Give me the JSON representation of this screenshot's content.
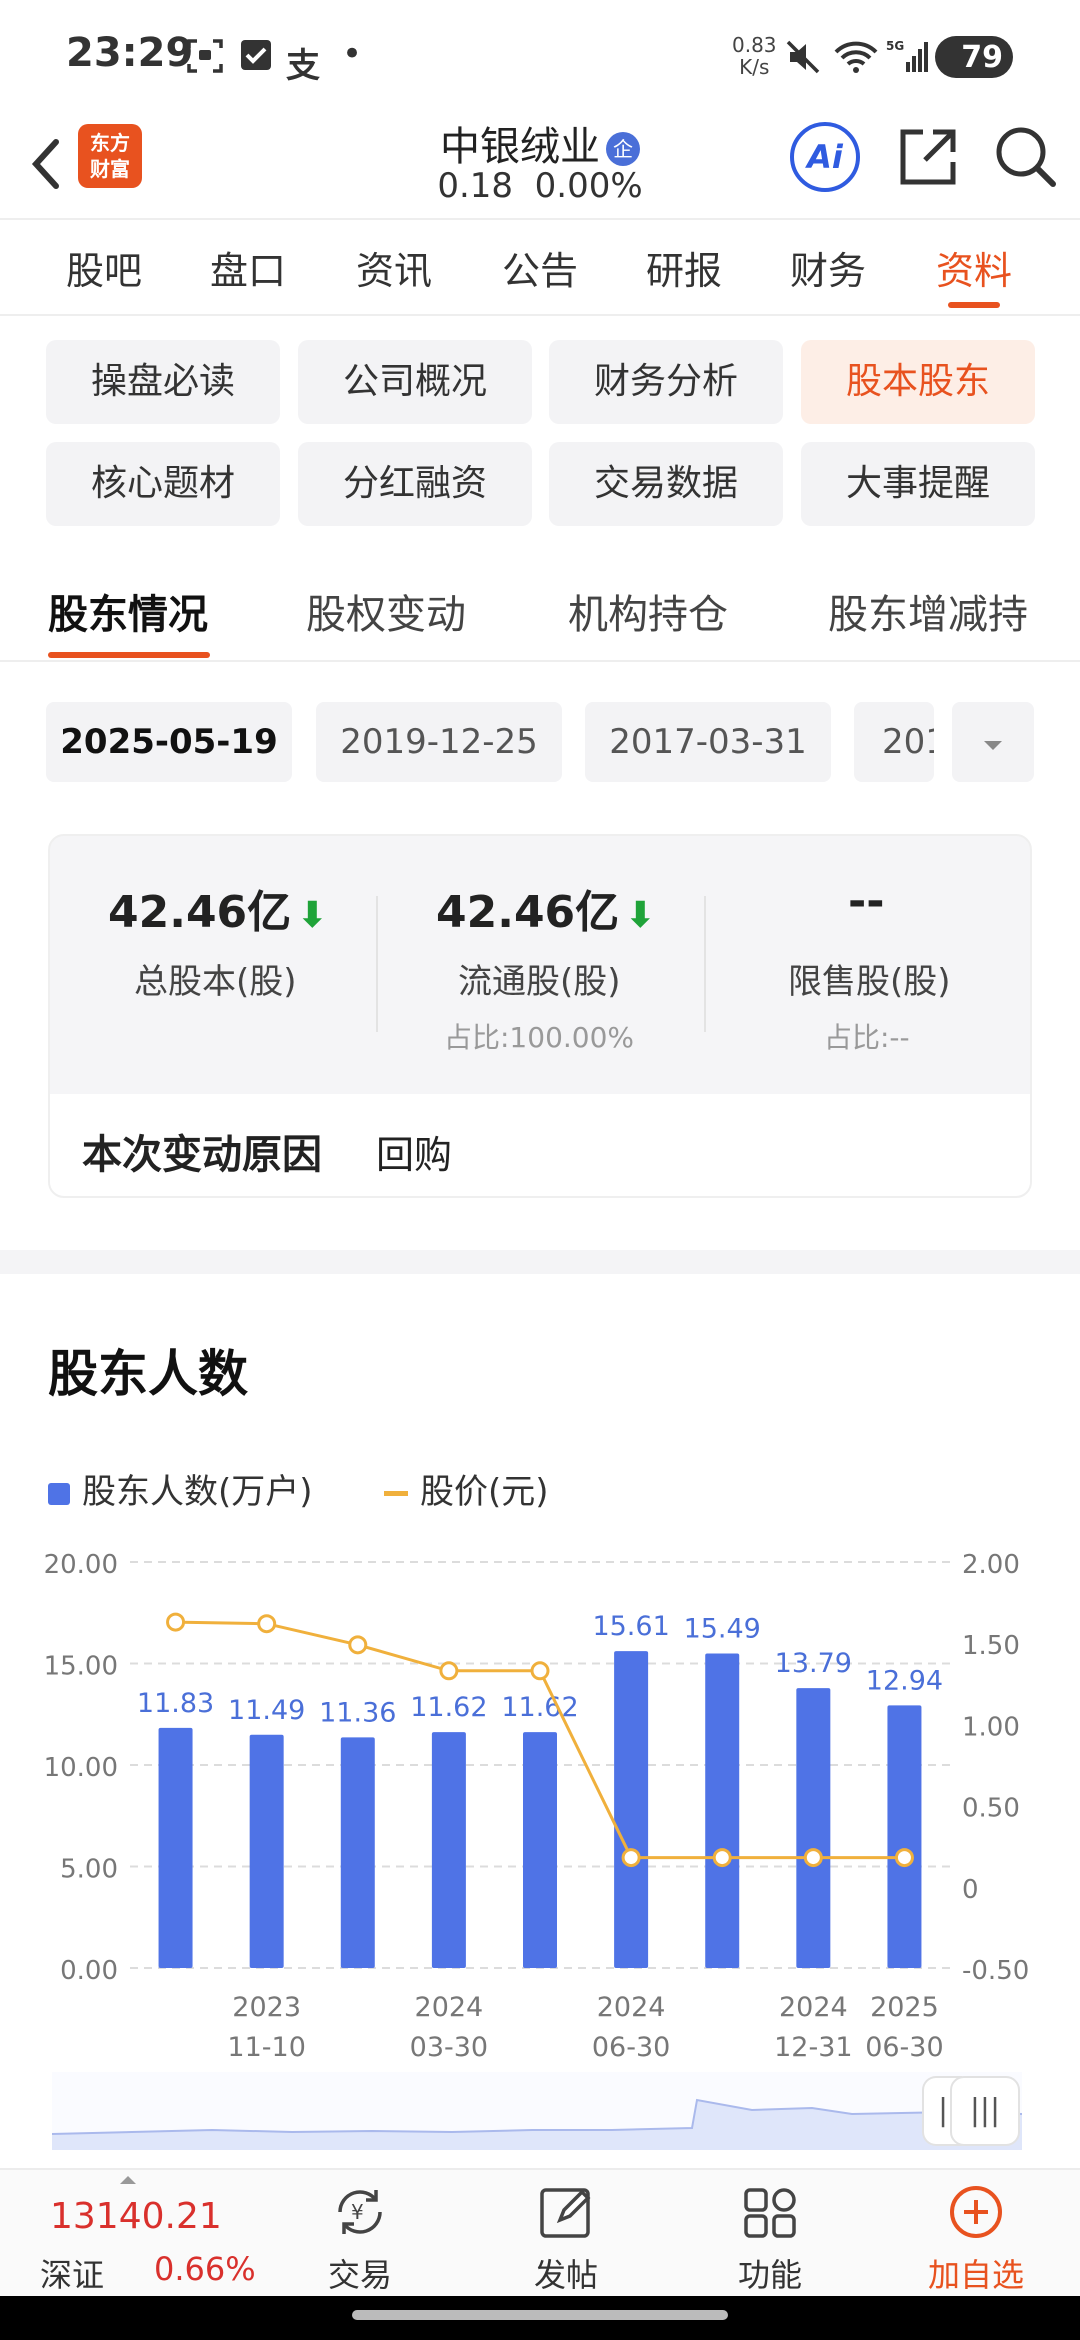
{
  "status_bar": {
    "time": "23:29",
    "icons": [
      "screenshot-icon",
      "check-icon",
      "alipay-icon",
      "dot-icon"
    ],
    "net_speed_value": "0.83",
    "net_speed_unit": "K/s",
    "battery": "79"
  },
  "header": {
    "logo_line1": "东方",
    "logo_line2": "财富",
    "stock_name": "中银绒业",
    "badge": "企",
    "price": "0.18",
    "change": "0.00%",
    "ai_label": "Ai"
  },
  "main_tabs": [
    {
      "label": "股吧"
    },
    {
      "label": "盘口"
    },
    {
      "label": "资讯"
    },
    {
      "label": "公告"
    },
    {
      "label": "研报"
    },
    {
      "label": "财务"
    },
    {
      "label": "资料"
    }
  ],
  "sub_menu": [
    {
      "label": "操盘必读"
    },
    {
      "label": "公司概况"
    },
    {
      "label": "财务分析"
    },
    {
      "label": "股本股东"
    },
    {
      "label": "核心题材"
    },
    {
      "label": "分红融资"
    },
    {
      "label": "交易数据"
    },
    {
      "label": "大事提醒"
    }
  ],
  "shareholder_tabs": [
    {
      "label": "股东情况"
    },
    {
      "label": "股权变动"
    },
    {
      "label": "机构持仓"
    },
    {
      "label": "股东增减持"
    }
  ],
  "dates": [
    "2025-05-19",
    "2019-12-25",
    "2017-03-31",
    "201"
  ],
  "share_card": {
    "total": {
      "value": "42.46亿",
      "label": "总股本(股)"
    },
    "float": {
      "value": "42.46亿",
      "label": "流通股(股)",
      "ratio": "占比:100.00%"
    },
    "restricted": {
      "value": "--",
      "label": "限售股(股)",
      "ratio": "占比:--"
    },
    "reason_label": "本次变动原因",
    "reason_value": "回购"
  },
  "chart_section": {
    "title": "股东人数",
    "legend_bar": "股东人数(万户)",
    "legend_line": "股价(元)"
  },
  "chart_data": {
    "type": "bar",
    "left_axis_ticks": [
      "20.00",
      "15.00",
      "10.00",
      "5.00",
      "0.00"
    ],
    "right_axis_ticks": [
      "2.00",
      "1.50",
      "1.00",
      "0.50",
      "0",
      "-0.50"
    ],
    "ylim_left": [
      0,
      20
    ],
    "ylim_right": [
      -0.5,
      2.0
    ],
    "x_labels": [
      {
        "index": 1,
        "year": "2023",
        "date": "11-10"
      },
      {
        "index": 3,
        "year": "2024",
        "date": "03-30"
      },
      {
        "index": 5,
        "year": "2024",
        "date": "06-30"
      },
      {
        "index": 7,
        "year": "2024",
        "date": "12-31"
      },
      {
        "index": 8,
        "year": "2025",
        "date": "06-30"
      }
    ],
    "series": [
      {
        "name": "股东人数(万户)",
        "kind": "bar",
        "color": "#4f73e6",
        "values": [
          11.83,
          11.49,
          11.36,
          11.62,
          11.62,
          15.61,
          15.49,
          13.79,
          12.94
        ],
        "labels": [
          "11.83",
          "11.49",
          "11.36",
          "11.62",
          "11.62",
          "15.61",
          "15.49",
          "13.79",
          "12.94"
        ]
      },
      {
        "name": "股价(元)",
        "kind": "line",
        "color": "#f0b03c",
        "values": [
          1.63,
          1.62,
          1.49,
          1.33,
          1.33,
          0.18,
          0.18,
          0.18,
          0.18
        ]
      }
    ]
  },
  "bottom_bar": {
    "index_value": "13140.21",
    "index_name": "深证",
    "index_change": "0.66%",
    "items": [
      {
        "label": "交易"
      },
      {
        "label": "发帖"
      },
      {
        "label": "功能"
      },
      {
        "label": "加自选"
      }
    ]
  }
}
